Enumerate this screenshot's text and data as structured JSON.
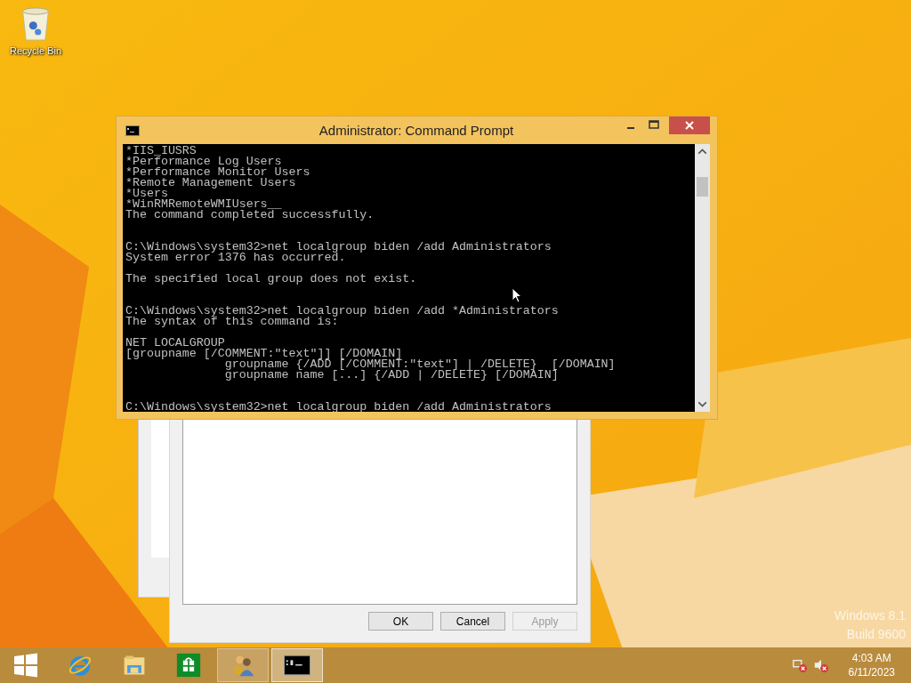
{
  "desktop_icons": [
    {
      "label": "Recycle Bin"
    }
  ],
  "console_window": {
    "title": "Administrator: Command Prompt",
    "blocks": [
      {
        "kind": "output",
        "lines": [
          "*IIS_IUSRS",
          "*Performance Log Users",
          "*Performance Monitor Users",
          "*Remote Management Users",
          "*Users",
          "*WinRMRemoteWMIUsers__",
          "The command completed successfully."
        ]
      },
      {
        "kind": "command",
        "lines": [
          "C:\\Windows\\system32>net localgroup biden /add Administrators",
          "System error 1376 has occurred."
        ]
      },
      {
        "kind": "output",
        "lines": [
          "The specified local group does not exist."
        ]
      },
      {
        "kind": "command",
        "lines": [
          "C:\\Windows\\system32>net localgroup biden /add *Administrators",
          "The syntax of this command is:"
        ]
      },
      {
        "kind": "output",
        "lines": [
          "NET LOCALGROUP",
          "[groupname [/COMMENT:\"text\"]] [/DOMAIN]",
          "              groupname {/ADD [/COMMENT:\"text\"] | /DELETE}  [/DOMAIN]",
          "              groupname name [...] {/ADD | /DELETE} [/DOMAIN]"
        ]
      },
      {
        "kind": "command",
        "lines": [
          "C:\\Windows\\system32>net localgroup biden /add Administrators"
        ]
      }
    ]
  },
  "dialog": {
    "buttons": [
      {
        "label": "OK",
        "disabled": false
      },
      {
        "label": "Cancel",
        "disabled": false
      },
      {
        "label": "Apply",
        "disabled": true
      }
    ]
  },
  "watermark": [
    "Windows 8.1",
    "Build 9600"
  ],
  "taskbar": {
    "items": [
      {
        "kind": "start",
        "open": false,
        "selected": false
      },
      {
        "kind": "browser",
        "open": false,
        "selected": false
      },
      {
        "kind": "files",
        "open": false,
        "selected": false
      },
      {
        "kind": "store",
        "open": false,
        "selected": false
      },
      {
        "kind": "users",
        "open": true,
        "selected": false
      },
      {
        "kind": "console",
        "open": true,
        "selected": true
      }
    ],
    "time": "4:03 AM",
    "date": "6/11/2023"
  }
}
